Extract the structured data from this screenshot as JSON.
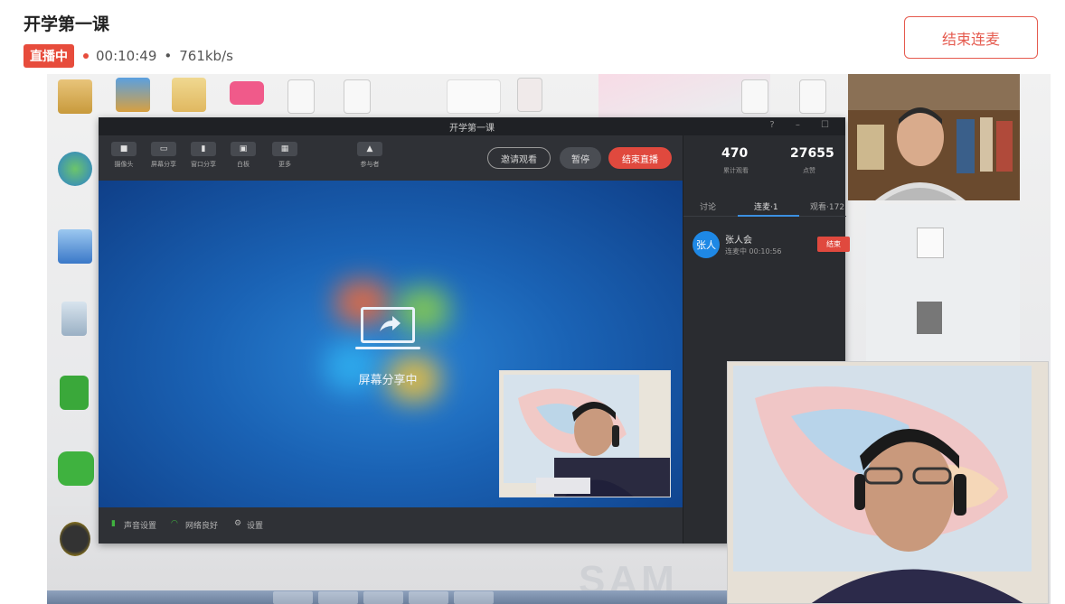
{
  "header": {
    "title": "开学第一课",
    "live_badge": "直播中",
    "elapsed": "00:10:49",
    "separator": "•",
    "bitrate": "761kb/s",
    "end_mic_button": "结束连麦"
  },
  "app_window": {
    "title": "开学第一课",
    "toolbar": [
      {
        "icon": "camera-icon",
        "label": "摄像头"
      },
      {
        "icon": "screen-share-icon",
        "label": "屏幕分享"
      },
      {
        "icon": "window-share-icon",
        "label": "窗口分享"
      },
      {
        "icon": "whiteboard-icon",
        "label": "白板"
      },
      {
        "icon": "more-icon",
        "label": "更多"
      },
      {
        "icon": "participants-icon",
        "label": "参与者"
      }
    ],
    "invite_button": "邀请观看",
    "pause_button": "暂停",
    "end_live_button": "结束直播",
    "screen_share_status": "屏幕分享中",
    "bottom_bar": {
      "audio": "声音设置",
      "network": "网络良好",
      "settings": "设置"
    },
    "side": {
      "stats": [
        {
          "value": "470",
          "label": "累计观看"
        },
        {
          "value": "27655",
          "label": "点赞"
        }
      ],
      "tabs": [
        "讨论",
        "连麦·1",
        "观看·172"
      ],
      "active_tab_index": 1,
      "mic_user": {
        "avatar_text": "张人",
        "name": "张人会",
        "status": "连麦中 00:10:56",
        "action": "结束"
      }
    }
  },
  "desktop": {
    "watermark": "SAM"
  },
  "colors": {
    "accent_red": "#e55a4e",
    "live_red": "#e74c3c",
    "tab_blue": "#3b8fe0"
  }
}
